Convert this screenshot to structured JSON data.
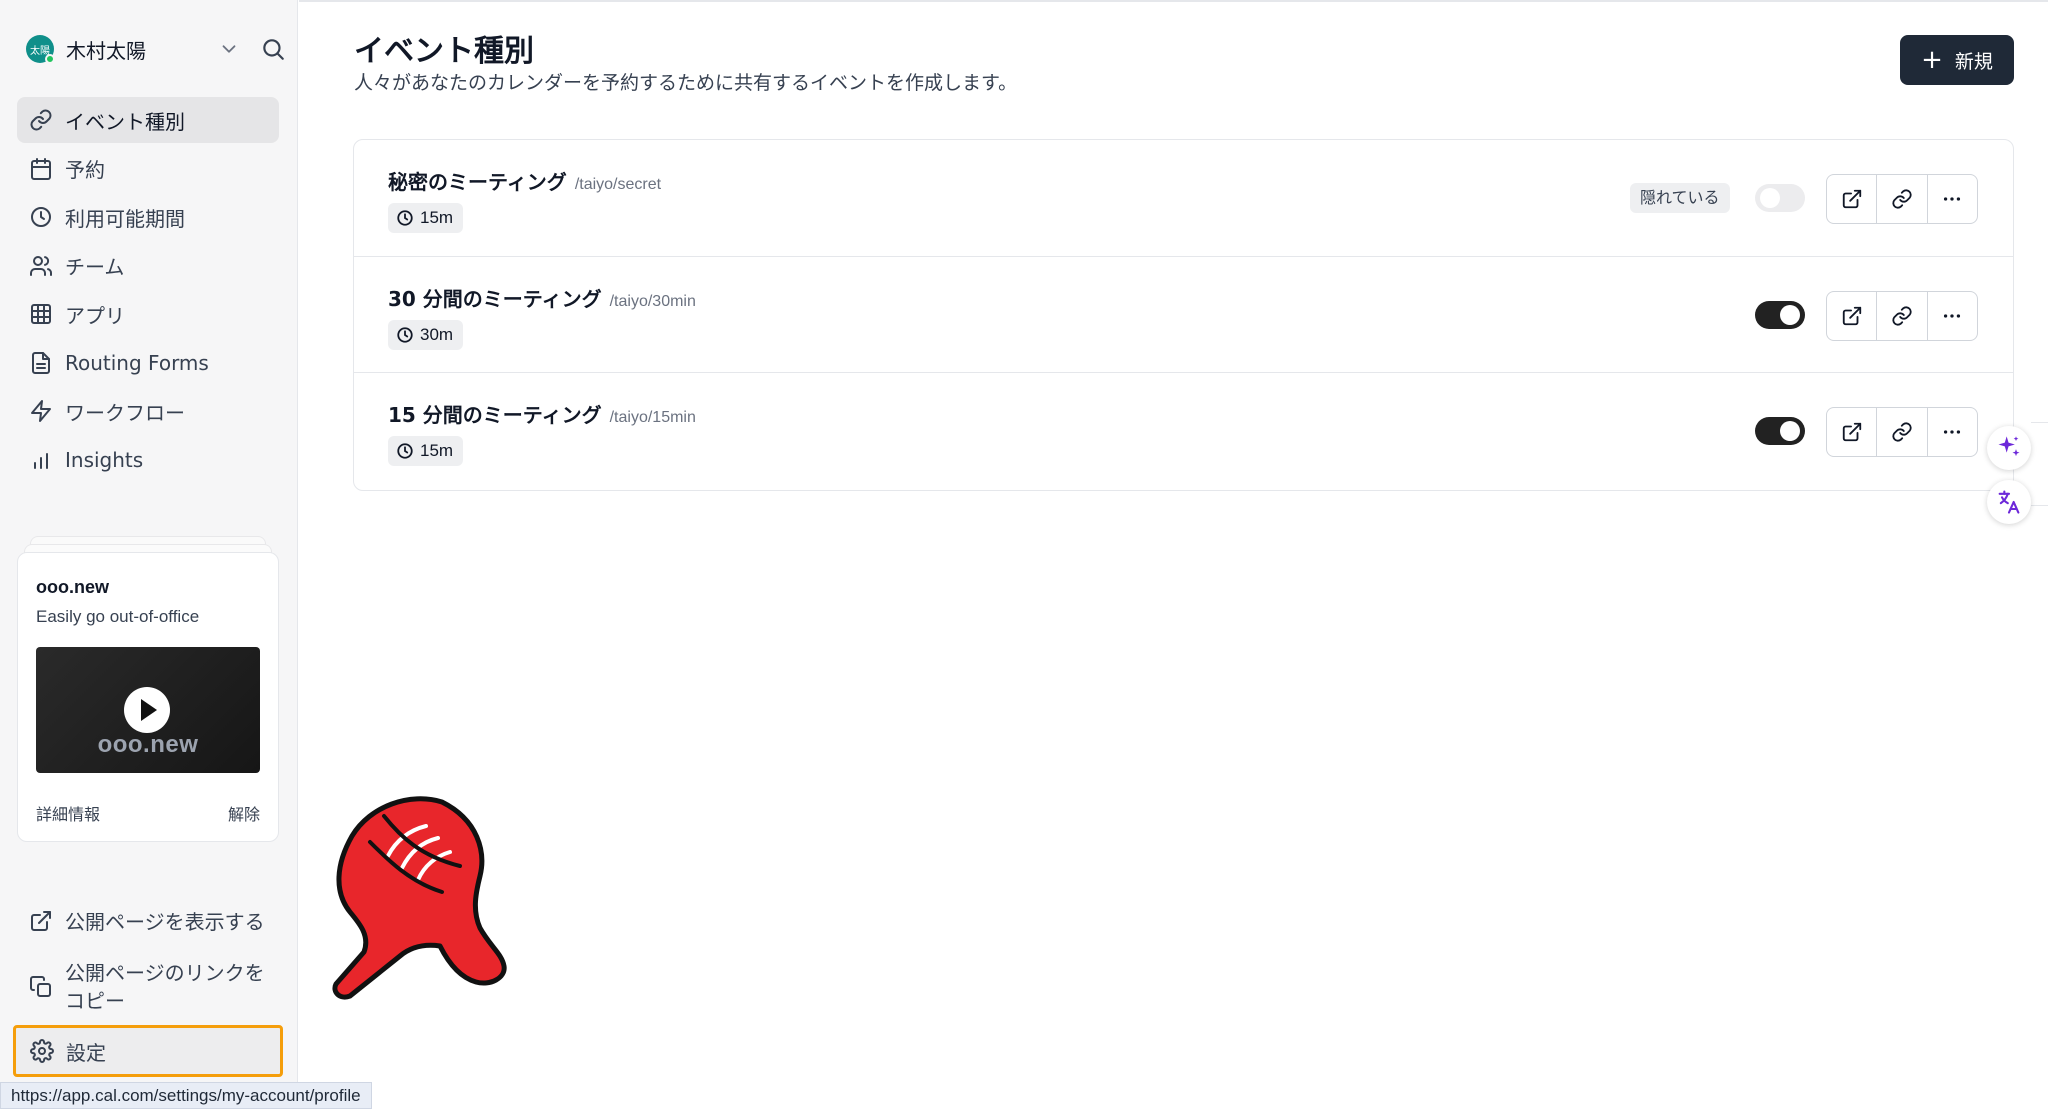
{
  "user": {
    "avatar_text": "太陽",
    "name": "木村太陽"
  },
  "nav": {
    "items": [
      {
        "label": "イベント種別",
        "icon": "link-icon",
        "active": true
      },
      {
        "label": "予約",
        "icon": "calendar-icon"
      },
      {
        "label": "利用可能期間",
        "icon": "clock-icon"
      },
      {
        "label": "チーム",
        "icon": "users-icon"
      },
      {
        "label": "アプリ",
        "icon": "grid-icon"
      },
      {
        "label": "Routing Forms",
        "icon": "file-text-icon"
      },
      {
        "label": "ワークフロー",
        "icon": "zap-icon"
      },
      {
        "label": "Insights",
        "icon": "bar-chart-icon"
      }
    ]
  },
  "promo": {
    "title": "ooo.new",
    "subtitle": "Easily go out-of-office",
    "video_logo": "ooo.new",
    "more_label": "詳細情報",
    "dismiss_label": "解除"
  },
  "bottom_nav": {
    "public_page": "公開ページを表示する",
    "copy_link_line1": "公開ページのリンクを",
    "copy_link_line2": "コピー",
    "settings": "設定"
  },
  "status_url": "https://app.cal.com/settings/my-account/profile",
  "page": {
    "title": "イベント種別",
    "subtitle": "人々があなたのカレンダーを予約するために共有するイベントを作成します。",
    "new_button": "新規"
  },
  "events": [
    {
      "title": "秘密のミーティング",
      "slug": "/taiyo/secret",
      "duration": "15m",
      "hidden_label": "隠れている",
      "enabled": false
    },
    {
      "title": "30 分間のミーティング",
      "slug": "/taiyo/30min",
      "duration": "30m",
      "enabled": true
    },
    {
      "title": "15 分間のミーティング",
      "slug": "/taiyo/15min",
      "duration": "15m",
      "enabled": true
    }
  ],
  "colors": {
    "accent_dark": "#1f2937",
    "settings_highlight": "#f59e0b",
    "avatar_bg": "#0f8f8a",
    "pointer_hand": "#e8262b",
    "sparkle": "#7c3aed"
  }
}
